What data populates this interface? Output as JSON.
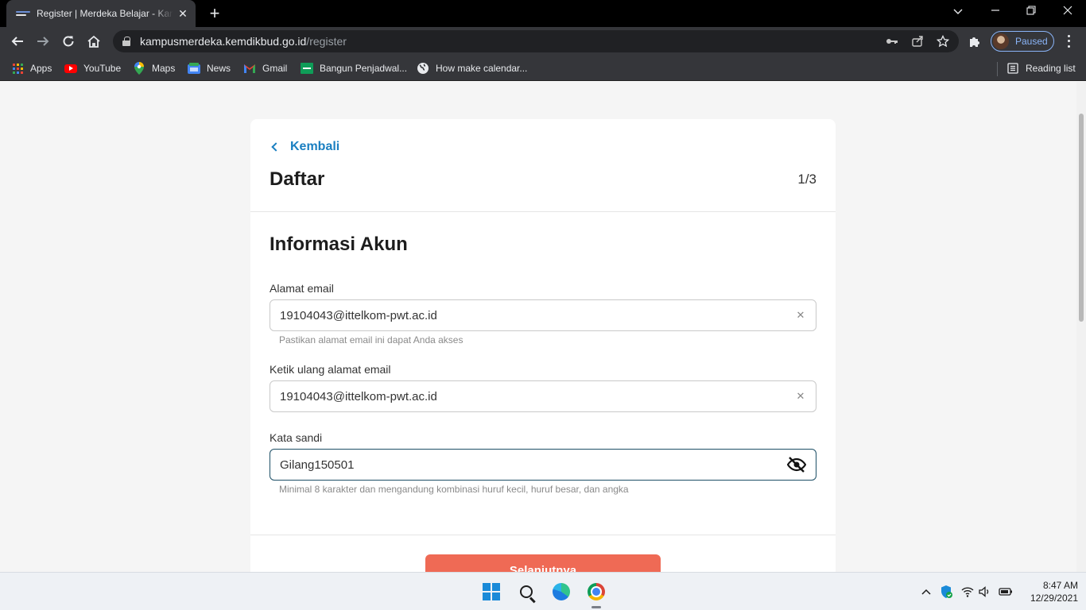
{
  "browser": {
    "tab_title": "Register | Merdeka Belajar - Kampus Merdeka",
    "url_host": "kampusmerdeka.kemdikbud.go.id",
    "url_path": "/register",
    "profile_label": "Paused",
    "bookmarks": [
      {
        "label": "Apps",
        "icon": "apps-grid-icon"
      },
      {
        "label": "YouTube",
        "icon": "youtube-icon"
      },
      {
        "label": "Maps",
        "icon": "maps-icon"
      },
      {
        "label": "News",
        "icon": "news-icon"
      },
      {
        "label": "Gmail",
        "icon": "gmail-icon"
      },
      {
        "label": "Bangun Penjadwal...",
        "icon": "sheets-icon"
      },
      {
        "label": "How make calendar...",
        "icon": "globe-icon"
      }
    ],
    "reading_list": "Reading list"
  },
  "page": {
    "back_label": "Kembali",
    "title": "Daftar",
    "step": "1/3",
    "section_title": "Informasi Akun",
    "email": {
      "label": "Alamat email",
      "value": "19104043@ittelkom-pwt.ac.id",
      "hint": "Pastikan alamat email ini dapat Anda akses"
    },
    "email_confirm": {
      "label": "Ketik ulang alamat email",
      "value": "19104043@ittelkom-pwt.ac.id"
    },
    "password": {
      "label": "Kata sandi",
      "value": "Gilang150501",
      "hint": "Minimal 8 karakter dan mengandung kombinasi huruf kecil, huruf besar, dan angka"
    },
    "next_button": "Selanjutnya"
  },
  "taskbar": {
    "time": "8:47 AM",
    "date": "12/29/2021"
  },
  "colors": {
    "accent_link": "#1a7fc1",
    "cta": "#ef6a55",
    "focus_border": "#1d4f66"
  }
}
